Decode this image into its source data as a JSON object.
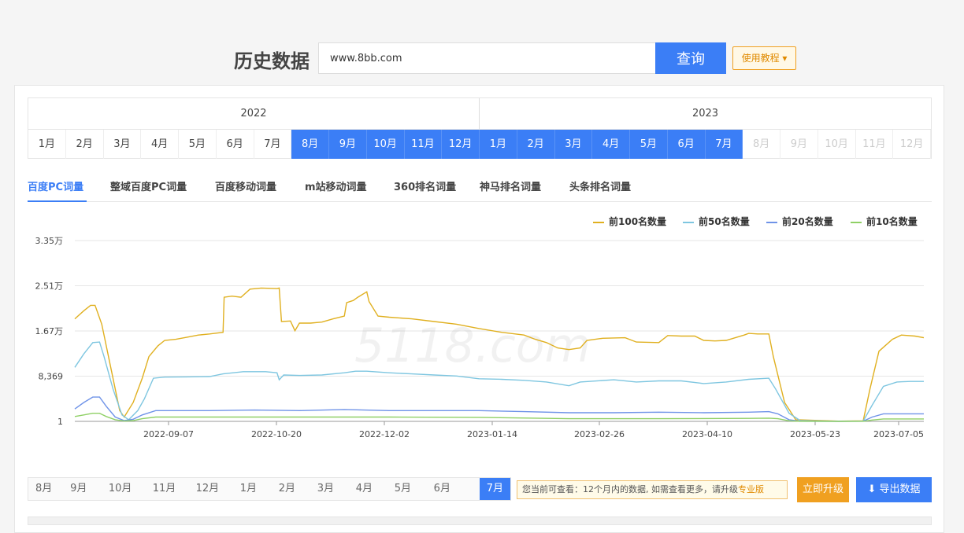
{
  "header": {
    "title": "历史数据",
    "search_value": "www.8bb.com",
    "search_button": "查询",
    "tutorial_button": "使用教程",
    "tutorial_arrow": "▾"
  },
  "years": [
    {
      "label": "2022",
      "months": [
        {
          "label": "1月",
          "state": "normal"
        },
        {
          "label": "2月",
          "state": "normal"
        },
        {
          "label": "3月",
          "state": "normal"
        },
        {
          "label": "4月",
          "state": "normal"
        },
        {
          "label": "5月",
          "state": "normal"
        },
        {
          "label": "6月",
          "state": "normal"
        },
        {
          "label": "7月",
          "state": "normal"
        },
        {
          "label": "8月",
          "state": "active"
        },
        {
          "label": "9月",
          "state": "active"
        },
        {
          "label": "10月",
          "state": "active"
        },
        {
          "label": "11月",
          "state": "active"
        },
        {
          "label": "12月",
          "state": "active"
        }
      ]
    },
    {
      "label": "2023",
      "months": [
        {
          "label": "1月",
          "state": "active"
        },
        {
          "label": "2月",
          "state": "active"
        },
        {
          "label": "3月",
          "state": "active"
        },
        {
          "label": "4月",
          "state": "active"
        },
        {
          "label": "5月",
          "state": "active"
        },
        {
          "label": "6月",
          "state": "active"
        },
        {
          "label": "7月",
          "state": "active"
        },
        {
          "label": "8月",
          "state": "disabled"
        },
        {
          "label": "9月",
          "state": "disabled"
        },
        {
          "label": "10月",
          "state": "disabled"
        },
        {
          "label": "11月",
          "state": "disabled"
        },
        {
          "label": "12月",
          "state": "disabled"
        }
      ]
    }
  ],
  "tabs": [
    {
      "label": "百度PC词量",
      "active": true
    },
    {
      "label": "整域百度PC词量",
      "active": false
    },
    {
      "label": "百度移动词量",
      "active": false
    },
    {
      "label": "m站移动词量",
      "active": false
    },
    {
      "label": "360排名词量",
      "active": false
    },
    {
      "label": "神马排名词量",
      "active": false
    },
    {
      "label": "头条排名词量",
      "active": false
    }
  ],
  "chart_data": {
    "type": "line",
    "y_ticks": [
      "3.35万",
      "2.51万",
      "1.67万",
      "8,369",
      "1"
    ],
    "ylim": [
      1,
      33500
    ],
    "x_ticks": [
      "2022-09-07",
      "2022-10-20",
      "2022-12-02",
      "2023-01-14",
      "2023-02-26",
      "2023-04-10",
      "2023-05-23",
      "2023-07-05"
    ],
    "grid": true,
    "legend_position": "top-right",
    "series": [
      {
        "name": "前100名数量",
        "color": "#e0b020",
        "values": [
          [
            0,
            19000
          ],
          [
            4,
            20500
          ],
          [
            7,
            21500
          ],
          [
            9,
            21500
          ],
          [
            12,
            18000
          ],
          [
            16,
            10000
          ],
          [
            20,
            2000
          ],
          [
            22,
            800
          ],
          [
            26,
            3500
          ],
          [
            30,
            8000
          ],
          [
            33,
            12000
          ],
          [
            37,
            14000
          ],
          [
            40,
            15000
          ],
          [
            45,
            15200
          ],
          [
            50,
            15600
          ],
          [
            55,
            16000
          ],
          [
            60,
            16200
          ],
          [
            66,
            16500
          ],
          [
            66.5,
            23000
          ],
          [
            70,
            23200
          ],
          [
            74,
            23000
          ],
          [
            78,
            24500
          ],
          [
            83,
            24700
          ],
          [
            90,
            24600
          ],
          [
            91,
            24700
          ],
          [
            92,
            18500
          ],
          [
            96,
            18600
          ],
          [
            98,
            16800
          ],
          [
            100,
            18200
          ],
          [
            105,
            18200
          ],
          [
            110,
            18400
          ],
          [
            115,
            19000
          ],
          [
            120,
            19500
          ],
          [
            121,
            22000
          ],
          [
            124,
            22400
          ],
          [
            126,
            23000
          ],
          [
            130,
            24000
          ],
          [
            131,
            22200
          ],
          [
            135,
            19500
          ],
          [
            140,
            19300
          ],
          [
            150,
            19000
          ],
          [
            160,
            18500
          ],
          [
            170,
            18000
          ],
          [
            180,
            17200
          ],
          [
            190,
            16500
          ],
          [
            200,
            16000
          ],
          [
            205,
            15200
          ],
          [
            210,
            14600
          ],
          [
            215,
            13600
          ],
          [
            220,
            13300
          ],
          [
            225,
            13600
          ],
          [
            228,
            15000
          ],
          [
            235,
            15400
          ],
          [
            245,
            15500
          ],
          [
            250,
            14700
          ],
          [
            260,
            14600
          ],
          [
            264,
            15900
          ],
          [
            270,
            15800
          ],
          [
            276,
            15800
          ],
          [
            280,
            15000
          ],
          [
            285,
            14900
          ],
          [
            290,
            15000
          ],
          [
            298,
            16000
          ],
          [
            300,
            16300
          ],
          [
            304,
            16200
          ],
          [
            309,
            16200
          ],
          [
            311,
            12000
          ],
          [
            316,
            3500
          ],
          [
            321,
            300
          ],
          [
            340,
            50
          ],
          [
            351,
            100
          ],
          [
            354,
            6000
          ],
          [
            358,
            13000
          ],
          [
            364,
            15200
          ],
          [
            368,
            16000
          ],
          [
            374,
            15800
          ],
          [
            378,
            15500
          ]
        ]
      },
      {
        "name": "前50名数量",
        "color": "#7ec6e0",
        "values": [
          [
            0,
            10000
          ],
          [
            4,
            12500
          ],
          [
            8,
            14600
          ],
          [
            11,
            14700
          ],
          [
            13,
            12000
          ],
          [
            17,
            6000
          ],
          [
            21,
            1200
          ],
          [
            24,
            300
          ],
          [
            28,
            2000
          ],
          [
            31,
            4200
          ],
          [
            35,
            8000
          ],
          [
            40,
            8200
          ],
          [
            50,
            8250
          ],
          [
            60,
            8300
          ],
          [
            66,
            8800
          ],
          [
            75,
            9200
          ],
          [
            85,
            9200
          ],
          [
            90,
            9000
          ],
          [
            91,
            7700
          ],
          [
            93,
            8600
          ],
          [
            100,
            8500
          ],
          [
            110,
            8600
          ],
          [
            120,
            9000
          ],
          [
            125,
            9300
          ],
          [
            130,
            9300
          ],
          [
            140,
            9000
          ],
          [
            150,
            8800
          ],
          [
            160,
            8600
          ],
          [
            170,
            8400
          ],
          [
            180,
            7900
          ],
          [
            190,
            7800
          ],
          [
            200,
            7600
          ],
          [
            210,
            7300
          ],
          [
            220,
            6600
          ],
          [
            225,
            7300
          ],
          [
            240,
            7700
          ],
          [
            250,
            7300
          ],
          [
            260,
            7500
          ],
          [
            270,
            7500
          ],
          [
            280,
            7000
          ],
          [
            290,
            7300
          ],
          [
            300,
            7800
          ],
          [
            309,
            8000
          ],
          [
            312,
            6000
          ],
          [
            318,
            1500
          ],
          [
            323,
            150
          ],
          [
            340,
            20
          ],
          [
            351,
            50
          ],
          [
            355,
            3000
          ],
          [
            360,
            6500
          ],
          [
            366,
            7300
          ],
          [
            372,
            7400
          ],
          [
            378,
            7400
          ]
        ]
      },
      {
        "name": "前20名数量",
        "color": "#6f93e8",
        "values": [
          [
            0,
            2300
          ],
          [
            4,
            3500
          ],
          [
            8,
            4500
          ],
          [
            11,
            4500
          ],
          [
            14,
            2800
          ],
          [
            18,
            800
          ],
          [
            22,
            150
          ],
          [
            26,
            400
          ],
          [
            30,
            1200
          ],
          [
            36,
            2000
          ],
          [
            45,
            2000
          ],
          [
            60,
            2000
          ],
          [
            80,
            2100
          ],
          [
            100,
            2000
          ],
          [
            120,
            2200
          ],
          [
            140,
            2000
          ],
          [
            160,
            2000
          ],
          [
            180,
            2000
          ],
          [
            200,
            1800
          ],
          [
            220,
            1600
          ],
          [
            240,
            1600
          ],
          [
            260,
            1700
          ],
          [
            280,
            1600
          ],
          [
            300,
            1700
          ],
          [
            309,
            1800
          ],
          [
            313,
            1400
          ],
          [
            318,
            300
          ],
          [
            323,
            30
          ],
          [
            340,
            10
          ],
          [
            351,
            30
          ],
          [
            355,
            800
          ],
          [
            360,
            1400
          ],
          [
            378,
            1400
          ]
        ]
      },
      {
        "name": "前10名数量",
        "color": "#8fd065",
        "values": [
          [
            0,
            900
          ],
          [
            4,
            1200
          ],
          [
            8,
            1500
          ],
          [
            11,
            1500
          ],
          [
            14,
            900
          ],
          [
            18,
            300
          ],
          [
            22,
            60
          ],
          [
            26,
            150
          ],
          [
            30,
            500
          ],
          [
            36,
            800
          ],
          [
            60,
            800
          ],
          [
            100,
            800
          ],
          [
            140,
            800
          ],
          [
            180,
            750
          ],
          [
            220,
            500
          ],
          [
            260,
            500
          ],
          [
            300,
            550
          ],
          [
            309,
            600
          ],
          [
            313,
            500
          ],
          [
            318,
            100
          ],
          [
            323,
            10
          ],
          [
            340,
            5
          ],
          [
            351,
            10
          ],
          [
            355,
            250
          ],
          [
            360,
            450
          ],
          [
            378,
            450
          ]
        ]
      }
    ]
  },
  "bottom": {
    "months": [
      {
        "label": "8月"
      },
      {
        "label": "9月"
      },
      {
        "label": "10月"
      },
      {
        "label": "11月"
      },
      {
        "label": "12月"
      },
      {
        "label": "1月"
      },
      {
        "label": "2月"
      },
      {
        "label": "3月"
      },
      {
        "label": "4月"
      },
      {
        "label": "5月"
      },
      {
        "label": "6月"
      },
      {
        "label": "7月",
        "active": true
      }
    ],
    "notice_text": "您当前可查看：12个月内的数据, 如需查看更多，请升级",
    "notice_link": "专业版",
    "upgrade_button": "立即升级",
    "export_button": "导出数据",
    "export_icon": "download-icon"
  }
}
